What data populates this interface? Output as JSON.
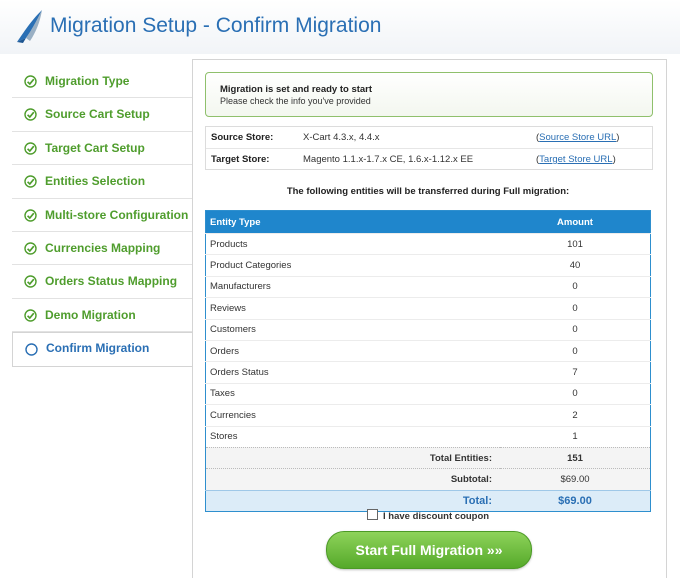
{
  "header": {
    "title": "Migration Setup - Confirm Migration",
    "logo_icon": "bird-logo-icon"
  },
  "sidebar": {
    "items": [
      {
        "label": "Migration Type",
        "status": "done"
      },
      {
        "label": "Source Cart Setup",
        "status": "done"
      },
      {
        "label": "Target Cart Setup",
        "status": "done"
      },
      {
        "label": "Entities Selection",
        "status": "done"
      },
      {
        "label": "Multi-store Configuration",
        "status": "done"
      },
      {
        "label": "Currencies Mapping",
        "status": "done"
      },
      {
        "label": "Orders Status Mapping",
        "status": "done"
      },
      {
        "label": "Demo Migration",
        "status": "done"
      },
      {
        "label": "Confirm Migration",
        "status": "current"
      }
    ],
    "done_color": "#4f9d2d",
    "current_color": "#2a6fb4"
  },
  "notice": {
    "title": "Migration is set and ready to start",
    "subtitle": "Please check the info you've provided"
  },
  "stores": {
    "source_label": "Source Store:",
    "source_value": "X-Cart 4.3.x, 4.4.x",
    "source_link": "Source Store URL",
    "target_label": "Target Store:",
    "target_value": "Magento 1.1.x-1.7.x CE, 1.6.x-1.12.x EE",
    "target_link": "Target Store URL",
    "paren_open": "(",
    "paren_close": ")"
  },
  "entities": {
    "caption": "The following entities will be transferred during Full migration:",
    "col_type": "Entity Type",
    "col_amount": "Amount",
    "rows": [
      {
        "type": "Products",
        "amount": "101"
      },
      {
        "type": "Product Categories",
        "amount": "40"
      },
      {
        "type": "Manufacturers",
        "amount": "0"
      },
      {
        "type": "Reviews",
        "amount": "0"
      },
      {
        "type": "Customers",
        "amount": "0"
      },
      {
        "type": "Orders",
        "amount": "0"
      },
      {
        "type": "Orders Status",
        "amount": "7"
      },
      {
        "type": "Taxes",
        "amount": "0"
      },
      {
        "type": "Currencies",
        "amount": "2"
      },
      {
        "type": "Stores",
        "amount": "1"
      }
    ],
    "total_label": "Total Entities:",
    "total_value": "151",
    "subtotal_label": "Subtotal:",
    "subtotal_value": "$69.00",
    "grand_label": "Total:",
    "grand_value": "$69.00"
  },
  "coupon": {
    "label": "I have discount coupon",
    "checked": false
  },
  "start_button": {
    "label": "Start Full Migration »»"
  },
  "colors": {
    "title_blue": "#2a6fb4",
    "table_header": "#1f86cc",
    "button_green": "#55a92a"
  }
}
